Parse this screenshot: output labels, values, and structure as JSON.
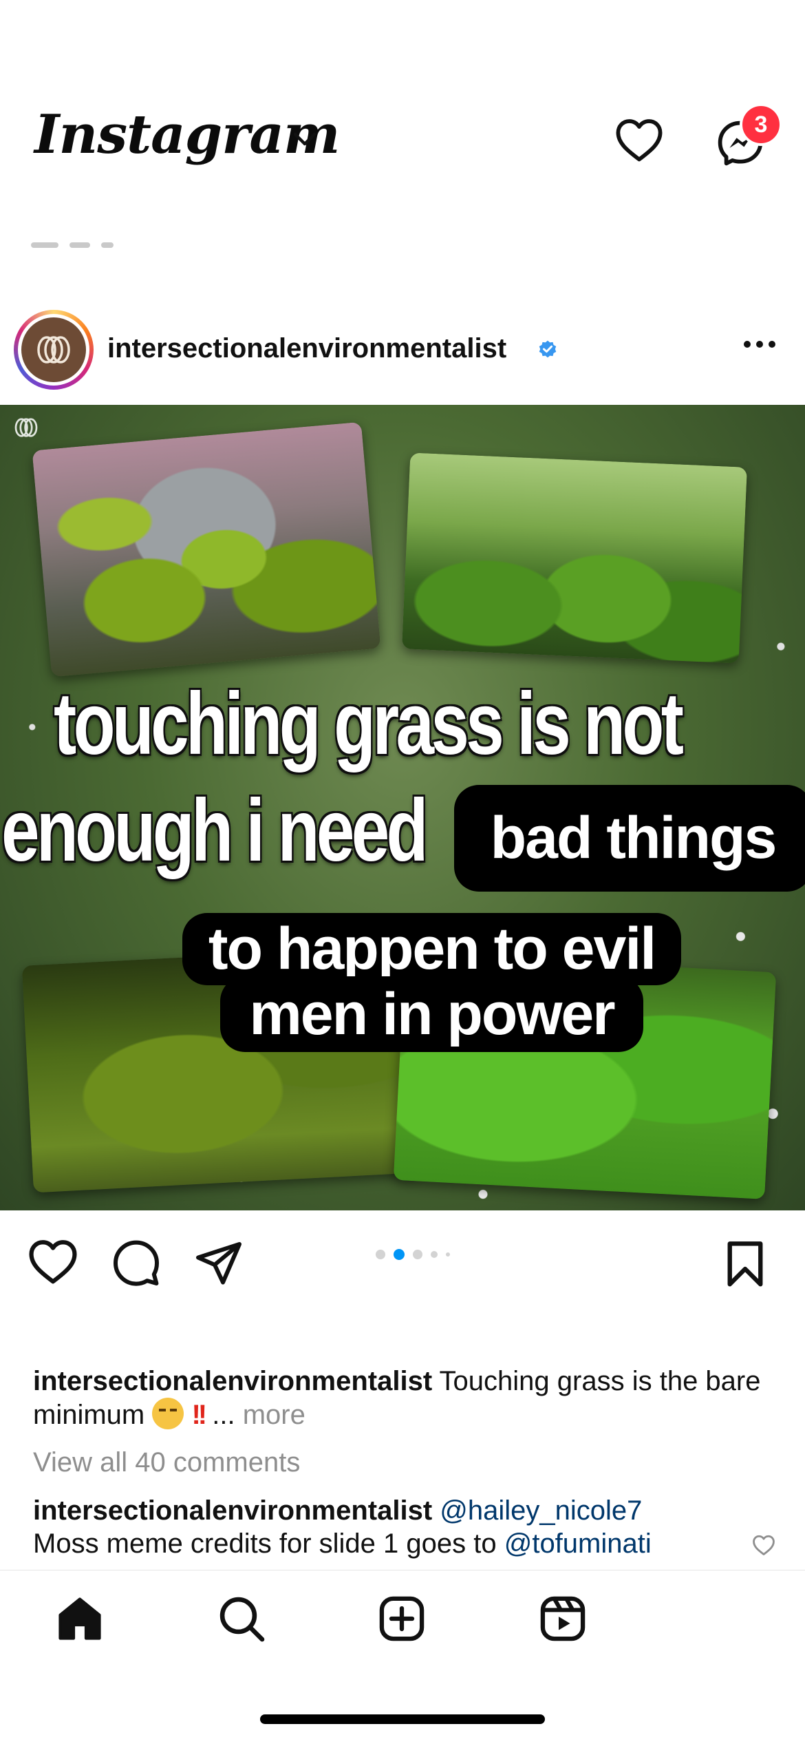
{
  "header": {
    "app_title": "Instagram",
    "notification_count": "3"
  },
  "post": {
    "username": "intersectionalenvironmentalist",
    "image_text": {
      "line1": "touching grass is not",
      "line2": "enough i need",
      "pill1": "bad things",
      "pill2": "to happen to evil",
      "pill3": "men in power"
    },
    "carousel": {
      "total": 5,
      "active_index": 1
    }
  },
  "caption": {
    "username": "intersectionalenvironmentalist",
    "text": "Touching grass is the bare minimum",
    "ellipsis": "...",
    "more_label": "more"
  },
  "view_all_comments": "View all 40 comments",
  "comment": {
    "username": "intersectionalenvironmentalist",
    "mention1": "@hailey_nicole7",
    "text": "Moss meme credits for slide 1 goes to",
    "mention2": "@tofuminati"
  },
  "tabbar": {
    "items": [
      "home",
      "search",
      "create",
      "reels"
    ]
  },
  "colors": {
    "accent_blue": "#0095f6",
    "badge_red": "#ff3040",
    "mention_blue": "#00376b",
    "muted_gray": "#8e8e8e"
  },
  "icons": [
    "chevron-down-icon",
    "heart-icon",
    "messenger-icon",
    "verified-icon",
    "more-icon",
    "comment-icon",
    "share-icon",
    "bookmark-icon",
    "home-icon",
    "search-icon",
    "create-icon",
    "reels-icon"
  ]
}
